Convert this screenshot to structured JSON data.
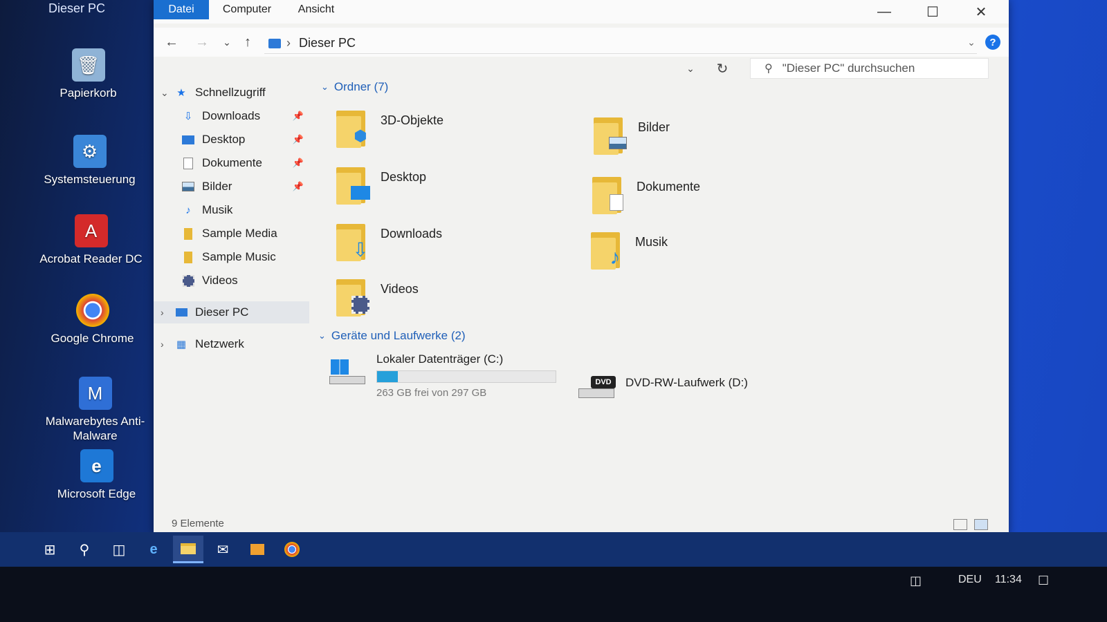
{
  "desktop": {
    "top_label": "Dieser PC",
    "icons": [
      {
        "label": "Papierkorb",
        "icon": "recycle-bin-icon"
      },
      {
        "label": "Systemsteuerung",
        "icon": "control-panel-icon"
      },
      {
        "label": "Acrobat Reader DC",
        "icon": "acrobat-icon"
      },
      {
        "label": "Google Chrome",
        "icon": "chrome-icon"
      },
      {
        "label": "Malwarebytes Anti-Malware",
        "icon": "malwarebytes-icon"
      },
      {
        "label": "Microsoft Edge",
        "icon": "edge-icon"
      }
    ]
  },
  "window": {
    "ribbon_tabs": [
      "Datei",
      "Computer",
      "Ansicht"
    ],
    "address": "Dieser PC",
    "search_placeholder": "\"Dieser PC\" durchsuchen"
  },
  "navpane": {
    "items": [
      {
        "label": "Schnellzugriff",
        "icon": "star-icon"
      },
      {
        "label": "Downloads",
        "icon": "download-icon",
        "pinned": true
      },
      {
        "label": "Desktop",
        "icon": "desktop-icon",
        "pinned": true
      },
      {
        "label": "Dokumente",
        "icon": "documents-icon",
        "pinned": true
      },
      {
        "label": "Bilder",
        "icon": "pictures-icon",
        "pinned": true
      },
      {
        "label": "Musik",
        "icon": "music-icon"
      },
      {
        "label": "Sample Media",
        "icon": "folder-icon"
      },
      {
        "label": "Sample Music",
        "icon": "folder-icon"
      },
      {
        "label": "Videos",
        "icon": "videos-icon"
      },
      {
        "label": "Dieser PC",
        "icon": "pc-icon"
      },
      {
        "label": "Netzwerk",
        "icon": "network-icon"
      }
    ]
  },
  "content": {
    "folders_header": "Ordner (7)",
    "folders": [
      {
        "label": "3D-Objekte",
        "icon": "3d-objects-icon"
      },
      {
        "label": "Bilder",
        "icon": "pictures-icon"
      },
      {
        "label": "Desktop",
        "icon": "desktop-icon"
      },
      {
        "label": "Dokumente",
        "icon": "documents-icon"
      },
      {
        "label": "Downloads",
        "icon": "download-icon"
      },
      {
        "label": "Musik",
        "icon": "music-icon"
      },
      {
        "label": "Videos",
        "icon": "videos-icon"
      }
    ],
    "devices_header": "Geräte und Laufwerke (2)",
    "drives": [
      {
        "label": "Lokaler Datenträger (C:)",
        "free": "263 GB frei von 297 GB",
        "used_fraction": 0.115,
        "icon": "hard-drive-icon"
      },
      {
        "label": "DVD-RW-Laufwerk (D:)",
        "icon": "dvd-drive-icon",
        "badge": "DVD"
      }
    ]
  },
  "status": {
    "item_count": "9 Elemente"
  },
  "taskbar": {
    "buttons": [
      "start-icon",
      "search-icon",
      "task-view-icon",
      "edge-icon",
      "file-explorer-icon",
      "mail-icon",
      "media-player-icon",
      "chrome-icon"
    ],
    "language": "DEU",
    "time": "11:34"
  },
  "colors": {
    "accent": "#1a6fd0",
    "folder": "#f5d36a",
    "group_header": "#1f5fb8",
    "drive_bar": "#26a0da"
  }
}
